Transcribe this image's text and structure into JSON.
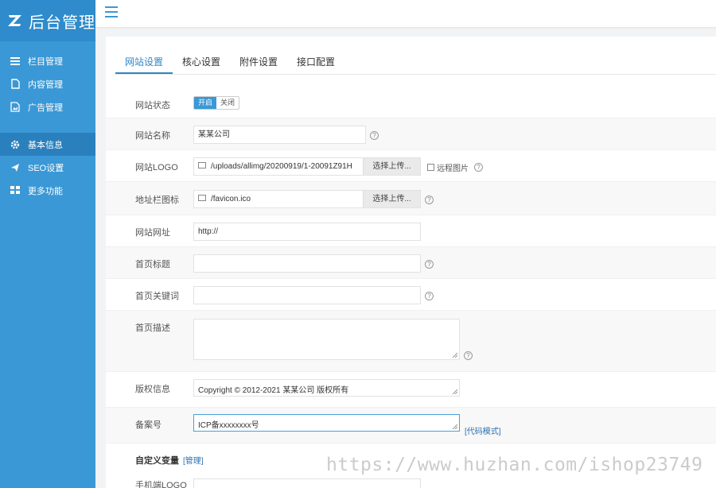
{
  "app": {
    "title": "后台管理"
  },
  "sidebar": {
    "items": [
      {
        "label": "栏目管理",
        "icon": "list-icon"
      },
      {
        "label": "内容管理",
        "icon": "document-icon"
      },
      {
        "label": "广告管理",
        "icon": "image-icon"
      },
      {
        "label": "基本信息",
        "icon": "gear-icon",
        "active": true
      },
      {
        "label": "SEO设置",
        "icon": "send-icon"
      },
      {
        "label": "更多功能",
        "icon": "grid-icon"
      }
    ]
  },
  "tabs": [
    "网站设置",
    "核心设置",
    "附件设置",
    "接口配置"
  ],
  "form": {
    "status": {
      "label": "网站状态",
      "on": "开启",
      "off": "关闭"
    },
    "name": {
      "label": "网站名称",
      "value": "某某公司"
    },
    "logo": {
      "label": "网站LOGO",
      "value": "/uploads/allimg/20200919/1-20091Z91H",
      "button": "选择上传...",
      "remote": "远程图片"
    },
    "favicon": {
      "label": "地址栏图标",
      "value": "/favicon.ico",
      "button": "选择上传..."
    },
    "url": {
      "label": "网站网址",
      "value": "http://"
    },
    "home_title": {
      "label": "首页标题",
      "value": ""
    },
    "home_keywords": {
      "label": "首页关键词",
      "value": ""
    },
    "home_desc": {
      "label": "首页描述",
      "value": ""
    },
    "copyright": {
      "label": "版权信息",
      "value": "Copyright © 2012-2021 某某公司 版权所有"
    },
    "icp": {
      "label": "备案号",
      "value": "ICP备xxxxxxxx号",
      "code_mode": "[代码模式]"
    },
    "custom_vars": {
      "label": "自定义变量",
      "manage": "[管理]"
    },
    "mobile_logo": {
      "label": "手机端LOGO"
    }
  },
  "watermark": "https://www.huzhan.com/ishop23749",
  "colors": {
    "sidebar": "#3a98d6",
    "active": "#2a80bd",
    "accent": "#2f86c6"
  }
}
